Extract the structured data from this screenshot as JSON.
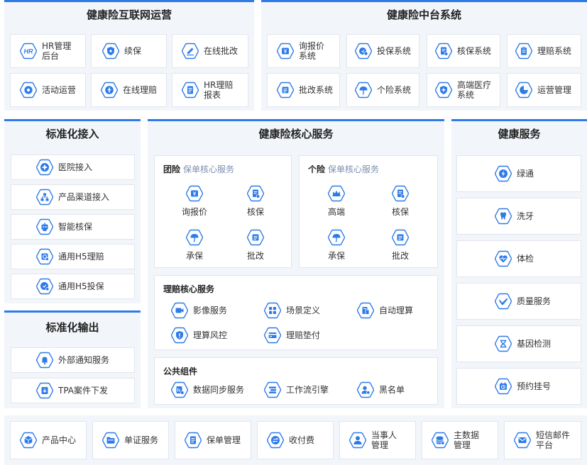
{
  "colors": {
    "accent": "#2e7be8",
    "panel_bg": "#f2f5fa",
    "card_border": "#e1e6ee"
  },
  "top_left": {
    "title": "健康险互联网运营",
    "items": [
      {
        "label": "HR管理后台",
        "icon": "hr-icon"
      },
      {
        "label": "续保",
        "icon": "shield-icon"
      },
      {
        "label": "在线批改",
        "icon": "pen-icon"
      },
      {
        "label": "活动运营",
        "icon": "gear-icon"
      },
      {
        "label": "在线理赔",
        "icon": "coin-icon"
      },
      {
        "label": "HR理赔报表",
        "icon": "report-icon"
      }
    ]
  },
  "top_right": {
    "title": "健康险中台系统",
    "items": [
      {
        "label": "询报价系统",
        "icon": "yen-icon"
      },
      {
        "label": "投保系统",
        "icon": "insure-icon"
      },
      {
        "label": "核保系统",
        "icon": "doc-check-icon"
      },
      {
        "label": "理赔系统",
        "icon": "clipboard-icon"
      },
      {
        "label": "批改系统",
        "icon": "list-icon"
      },
      {
        "label": "个险系统",
        "icon": "umbrella-icon"
      },
      {
        "label": "高端医疗系统",
        "icon": "medical-shield-icon"
      },
      {
        "label": "运营管理",
        "icon": "pie-icon"
      }
    ]
  },
  "std_access": {
    "title": "标准化接入",
    "items": [
      {
        "label": "医院接入",
        "icon": "medical-cross-icon"
      },
      {
        "label": "产品渠道接入",
        "icon": "network-icon"
      },
      {
        "label": "智能核保",
        "icon": "robot-icon"
      },
      {
        "label": "通用H5理赔",
        "icon": "h5-claim-icon"
      },
      {
        "label": "通用H5投保",
        "icon": "h5-insure-icon"
      }
    ]
  },
  "std_output": {
    "title": "标准化输出",
    "items": [
      {
        "label": "外部通知服务",
        "icon": "bell-icon"
      },
      {
        "label": "TPA案件下发",
        "icon": "download-icon"
      }
    ]
  },
  "core": {
    "title": "健康险核心服务",
    "group": {
      "title": "团险",
      "sub": "保单核心服务",
      "items": [
        {
          "label": "询报价",
          "icon": "yen-icon"
        },
        {
          "label": "核保",
          "icon": "doc-check-icon"
        },
        {
          "label": "承保",
          "icon": "umbrella-icon"
        },
        {
          "label": "批改",
          "icon": "list-icon"
        }
      ]
    },
    "personal": {
      "title": "个险",
      "sub": "保单核心服务",
      "items": [
        {
          "label": "高端",
          "icon": "crown-icon"
        },
        {
          "label": "核保",
          "icon": "doc-check-icon"
        },
        {
          "label": "承保",
          "icon": "umbrella-icon"
        },
        {
          "label": "批改",
          "icon": "list-icon"
        }
      ]
    },
    "claims": {
      "title": "理赔核心服务",
      "items": [
        {
          "label": "影像服务",
          "icon": "video-icon"
        },
        {
          "label": "场景定义",
          "icon": "grid-icon"
        },
        {
          "label": "自动理算",
          "icon": "auto-calc-icon"
        },
        {
          "label": "理算风控",
          "icon": "risk-icon"
        },
        {
          "label": "理赔垫付",
          "icon": "card-icon"
        }
      ]
    },
    "common": {
      "title": "公共组件",
      "items": [
        {
          "label": "数据同步服务",
          "icon": "sync-icon"
        },
        {
          "label": "工作流引擎",
          "icon": "flow-icon"
        },
        {
          "label": "黑名单",
          "icon": "user-block-icon"
        }
      ]
    }
  },
  "health": {
    "title": "健康服务",
    "items": [
      {
        "label": "绿通",
        "icon": "bolt-icon"
      },
      {
        "label": "洗牙",
        "icon": "tooth-icon"
      },
      {
        "label": "体检",
        "icon": "heartbeat-icon"
      },
      {
        "label": "质量服务",
        "icon": "check-heart-icon"
      },
      {
        "label": "基因检测",
        "icon": "dna-icon"
      },
      {
        "label": "预约挂号",
        "icon": "clock-icon"
      }
    ]
  },
  "bottom": {
    "items": [
      {
        "label": "产品中心",
        "icon": "cube-icon"
      },
      {
        "label": "单证服务",
        "icon": "folder-icon"
      },
      {
        "label": "保单管理",
        "icon": "report-icon"
      },
      {
        "label": "收付费",
        "icon": "exchange-icon"
      },
      {
        "label": "当事人管理",
        "icon": "person-icon"
      },
      {
        "label": "主数据管理",
        "icon": "database-icon"
      },
      {
        "label": "短信邮件平台",
        "icon": "mail-icon"
      }
    ]
  }
}
